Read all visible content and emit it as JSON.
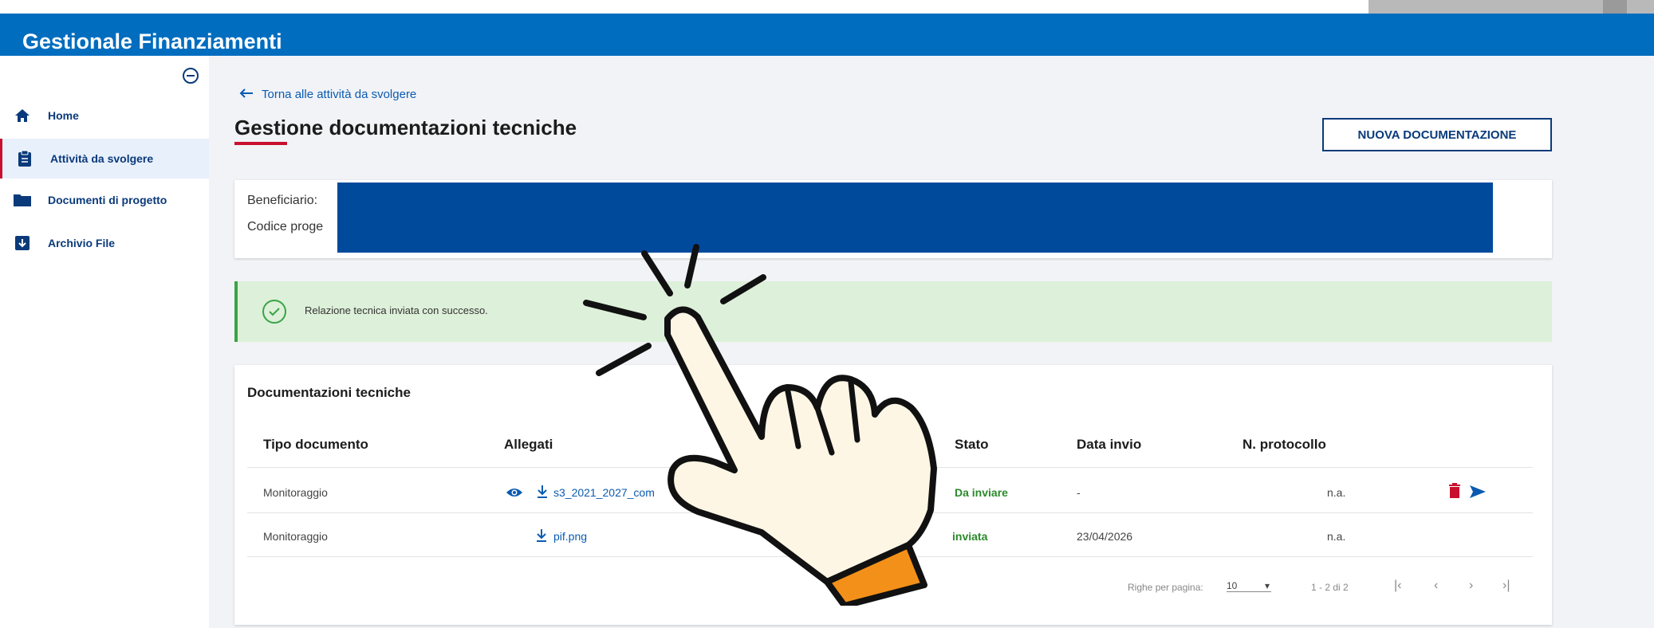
{
  "app": {
    "title": "Gestionale Finanziamenti"
  },
  "sidebar": {
    "items": [
      {
        "label": "Home",
        "icon": "home-icon",
        "active": false
      },
      {
        "label": "Attività da svolgere",
        "icon": "clipboard-icon",
        "active": true
      },
      {
        "label": "Documenti di progetto",
        "icon": "folder-icon",
        "active": false
      },
      {
        "label": "Archivio File",
        "icon": "archive-icon",
        "active": false
      }
    ]
  },
  "page": {
    "back_link": "Torna alle attività da svolgere",
    "title": "Gestione documentazioni tecniche",
    "new_button": "NUOVA DOCUMENTAZIONE"
  },
  "info": {
    "beneficiario_label": "Beneficiario:",
    "codice_label": "Codice proge"
  },
  "alert": {
    "message": "Relazione tecnica inviata con successo."
  },
  "table": {
    "title": "Documentazioni tecniche",
    "columns": [
      "Tipo documento",
      "Allegati",
      "Stato",
      "Data invio",
      "N. protocollo"
    ],
    "rows": [
      {
        "tipo": "Monitoraggio",
        "allegato": "s3_2021_2027_com",
        "stato": "Da inviare",
        "data": "-",
        "protocollo": "n.a."
      },
      {
        "tipo": "Monitoraggio",
        "allegato": "pif.png",
        "stato": "inviata",
        "data": "23/04/2026",
        "protocollo": "n.a."
      }
    ],
    "pagination": {
      "rows_label": "Righe per pagina:",
      "rows_value": "10",
      "range": "1 - 2 di 2"
    }
  },
  "colors": {
    "header": "#006dbf",
    "accent_red": "#c8102e",
    "alert_bg": "#ddf0d9",
    "redaction": "#004a9c",
    "hand_cuff": "#f39019"
  }
}
